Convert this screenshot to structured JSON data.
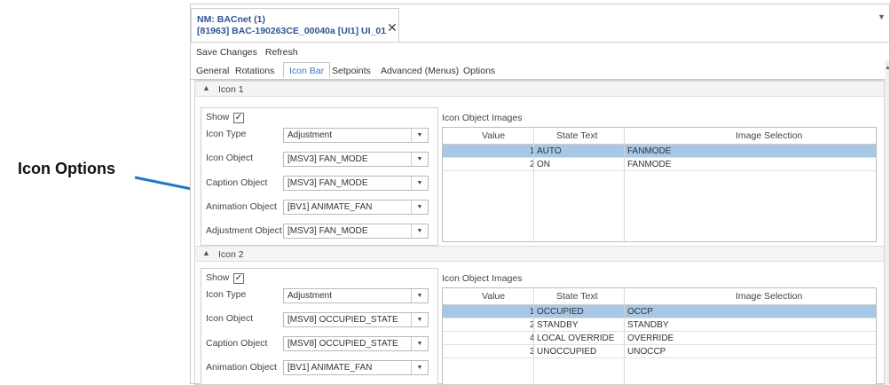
{
  "callout": {
    "label": "Icon Options"
  },
  "window": {
    "tab_line1": "NM: BACnet (1)",
    "tab_line2": "[81963] BAC-190263CE_00040a [UI1] UI_01",
    "close_glyph": "✕"
  },
  "toolbar": {
    "save": "Save Changes",
    "refresh": "Refresh"
  },
  "tabs": [
    "General",
    "Rotations",
    "Icon Bar",
    "Setpoints",
    "Advanced (Menus)",
    "Options"
  ],
  "active_tab": "Icon Bar",
  "sections": [
    {
      "title": "Icon 1",
      "show_label": "Show",
      "show_checked": true,
      "fields": [
        {
          "label": "Icon Type",
          "value": "Adjustment"
        },
        {
          "label": "Icon Object",
          "value": "[MSV3] FAN_MODE"
        },
        {
          "label": "Caption Object",
          "value": "[MSV3] FAN_MODE"
        },
        {
          "label": "Animation Object",
          "value": "[BV1] ANIMATE_FAN"
        },
        {
          "label": "Adjustment Object",
          "value": "[MSV3] FAN_MODE"
        }
      ],
      "images_title": "Icon Object Images",
      "columns": [
        "Value",
        "State Text",
        "Image Selection"
      ],
      "rows": [
        {
          "value": "1",
          "state": "AUTO",
          "image": "FANMODE",
          "selected": true
        },
        {
          "value": "2",
          "state": "ON",
          "image": "FANMODE",
          "selected": false
        }
      ]
    },
    {
      "title": "Icon 2",
      "show_label": "Show",
      "show_checked": true,
      "fields": [
        {
          "label": "Icon Type",
          "value": "Adjustment"
        },
        {
          "label": "Icon Object",
          "value": "[MSV8] OCCUPIED_STATE"
        },
        {
          "label": "Caption Object",
          "value": "[MSV8] OCCUPIED_STATE"
        },
        {
          "label": "Animation Object",
          "value": "[BV1] ANIMATE_FAN"
        }
      ],
      "images_title": "Icon Object Images",
      "columns": [
        "Value",
        "State Text",
        "Image Selection"
      ],
      "rows": [
        {
          "value": "1",
          "state": "OCCUPIED",
          "image": "OCCP",
          "selected": true
        },
        {
          "value": "2",
          "state": "STANDBY",
          "image": "STANDBY",
          "selected": false
        },
        {
          "value": "4",
          "state": "LOCAL OVERRIDE",
          "image": "OVERRIDE",
          "selected": false
        },
        {
          "value": "3",
          "state": "UNOCCUPIED",
          "image": "UNOCCP",
          "selected": false
        }
      ]
    }
  ],
  "icons": {
    "collapse": "chevron-up-icon",
    "dropdown": "chevron-down-icon",
    "check": "checkmark-icon",
    "arrow": "callout-arrow-icon"
  },
  "colors": {
    "selected_row": "#a7c7e7",
    "active_tab_text": "#3a78c2",
    "tab_title": "#2f5496",
    "arrow": "#1f78c8"
  }
}
